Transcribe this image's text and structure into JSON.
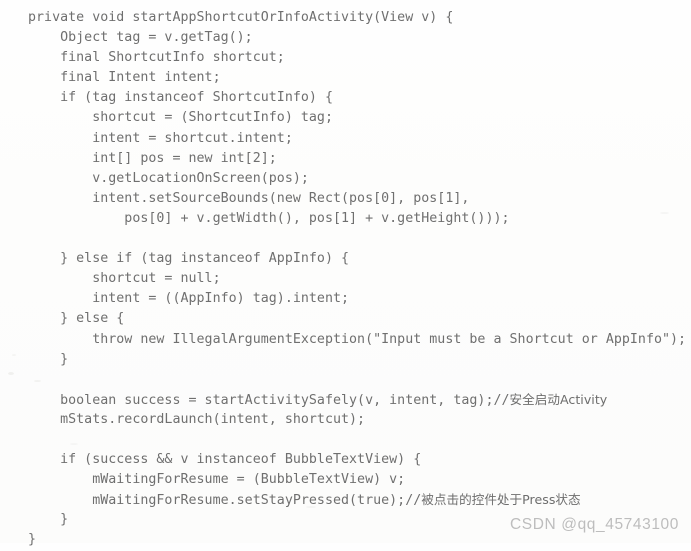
{
  "document": {
    "kind": "scanned-code-listing",
    "language": "Java",
    "colors": {
      "page_background": "#fefefe",
      "code_text": "#6f6f6f",
      "watermark_text": "#bdbdbd"
    }
  },
  "code": {
    "lines": [
      "private void startAppShortcutOrInfoActivity(View v) {",
      "    Object tag = v.getTag();",
      "    final ShortcutInfo shortcut;",
      "    final Intent intent;",
      "    if (tag instanceof ShortcutInfo) {",
      "        shortcut = (ShortcutInfo) tag;",
      "        intent = shortcut.intent;",
      "        int[] pos = new int[2];",
      "        v.getLocationOnScreen(pos);",
      "        intent.setSourceBounds(new Rect(pos[0], pos[1],",
      "            pos[0] + v.getWidth(), pos[1] + v.getHeight()));",
      "",
      "    } else if (tag instanceof AppInfo) {",
      "        shortcut = null;",
      "        intent = ((AppInfo) tag).intent;",
      "    } else {",
      "        throw new IllegalArgumentException(\"Input must be a Shortcut or AppInfo\");",
      "    }",
      "",
      "    boolean success = startActivitySafely(v, intent, tag);//安全启动Activity",
      "    mStats.recordLaunch(intent, shortcut);",
      "",
      "    if (success && v instanceof BubbleTextView) {",
      "        mWaitingForResume = (BubbleTextView) v;",
      "        mWaitingForResume.setStayPressed(true);//被点击的控件处于Press状态",
      "    }",
      "}"
    ],
    "segments": [
      {
        "text": "private void startAppShortcutOrInfoActivity(View v) {"
      },
      {
        "text": "    Object tag = v.getTag();"
      },
      {
        "text": "    final ShortcutInfo shortcut;"
      },
      {
        "text": "    final Intent intent;"
      },
      {
        "text": "    if (tag instanceof ShortcutInfo) {"
      },
      {
        "text": "        shortcut = (ShortcutInfo) tag;"
      },
      {
        "text": "        intent = shortcut.intent;"
      },
      {
        "text": "        int[] pos = new int[2];"
      },
      {
        "text": "        v.getLocationOnScreen(pos);"
      },
      {
        "text": "        intent.setSourceBounds(new Rect(pos[0], pos[1],"
      },
      {
        "text": "            pos[0] + v.getWidth(), pos[1] + v.getHeight()));"
      },
      {
        "text": ""
      },
      {
        "text": "    } else if (tag instanceof AppInfo) {"
      },
      {
        "text": "        shortcut = null;"
      },
      {
        "text": "        intent = ((AppInfo) tag).intent;"
      },
      {
        "text": "    } else {"
      },
      {
        "text": "        throw new IllegalArgumentException(\"Input must be a Shortcut or AppInfo\");"
      },
      {
        "text": "    }"
      },
      {
        "text": ""
      },
      {
        "code": "    boolean success = startActivitySafely(v, intent, tag);//",
        "comment": "安全启动Activity"
      },
      {
        "text": "    mStats.recordLaunch(intent, shortcut);"
      },
      {
        "text": ""
      },
      {
        "text": "    if (success && v instanceof BubbleTextView) {"
      },
      {
        "text": "        mWaitingForResume = (BubbleTextView) v;"
      },
      {
        "code": "        mWaitingForResume.setStayPressed(true);//",
        "comment": "被点击的控件处于Press状态"
      },
      {
        "text": "    }"
      },
      {
        "text": "}"
      }
    ],
    "comments": [
      "//安全启动Activity",
      "//被点击的控件处于Press状态"
    ]
  },
  "watermark": {
    "text": "CSDN @qq_45743100"
  }
}
